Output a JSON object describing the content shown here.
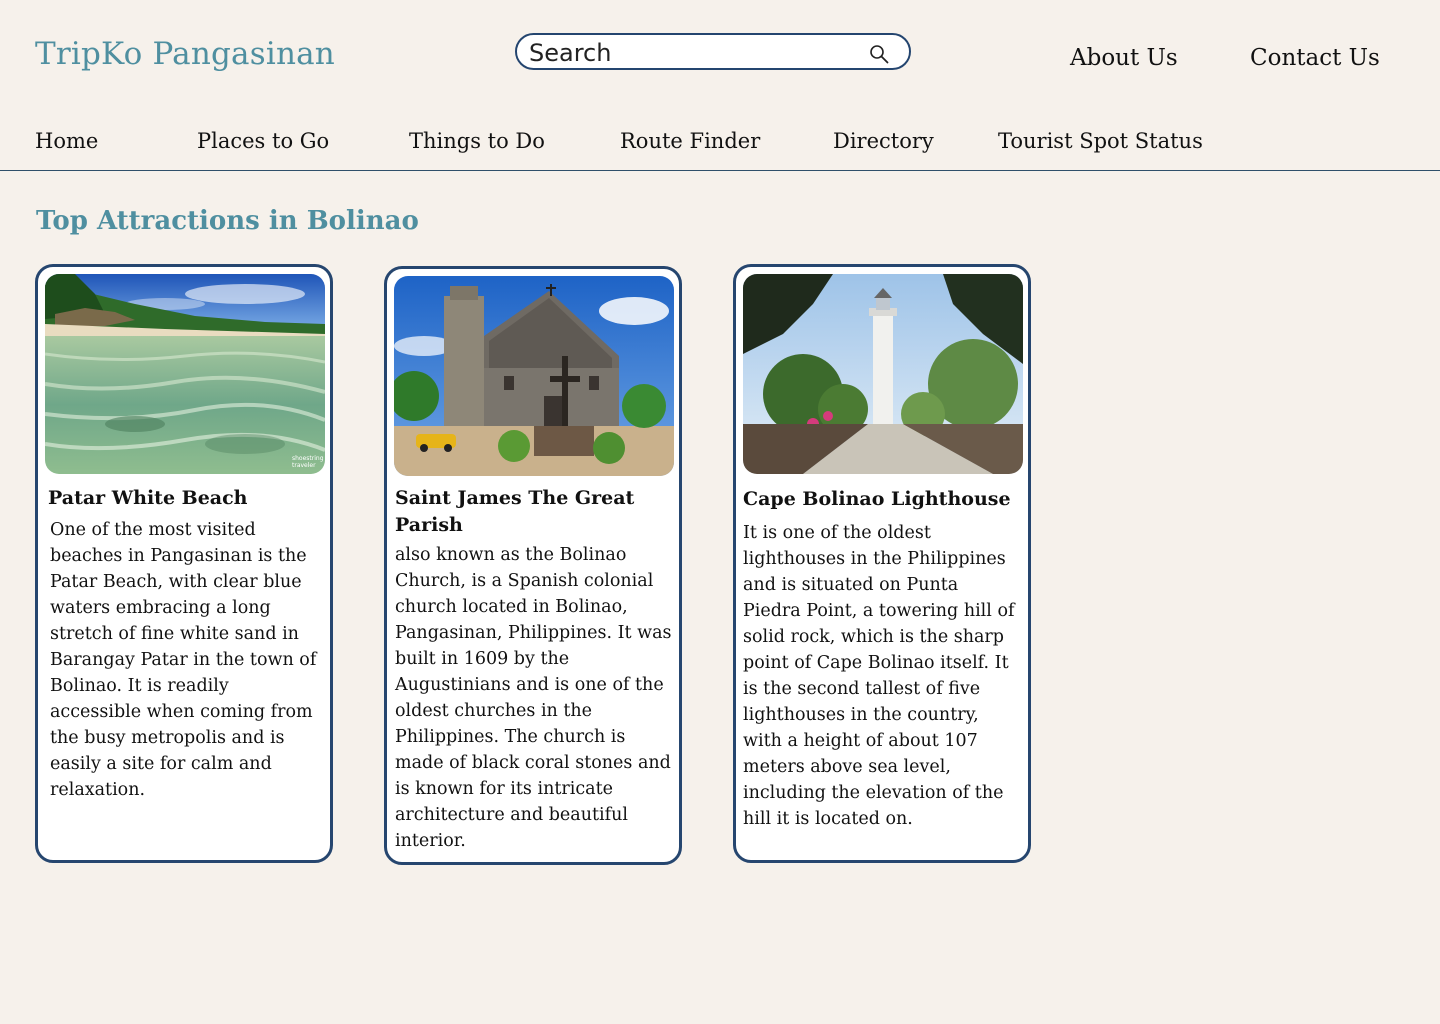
{
  "header": {
    "brand": "TripKo Pangasinan",
    "search_placeholder": "Search",
    "about_label": "About Us",
    "contact_label": "Contact Us"
  },
  "nav": {
    "items": [
      "Home",
      "Places to Go",
      "Things to Do",
      "Route Finder",
      "Directory",
      "Tourist Spot Status"
    ]
  },
  "section": {
    "title": "Top Attractions in Bolinao"
  },
  "cards": [
    {
      "title": "Patar White Beach",
      "description": "One of the most visited beaches in Pangasinan is the Patar Beach, with clear blue waters embracing a long stretch of fine white sand in Barangay Patar in the town of Bolinao. It is readily accessible when coming from the busy metropolis and is easily a site for calm and relaxation.",
      "watermark": "shoestring traveler"
    },
    {
      "title": "Saint James The Great Parish",
      "description": "also known as the Bolinao Church, is a Spanish colonial church located in Bolinao, Pangasinan, Philippines. It was built in 1609 by the Augustinians and is one of the oldest churches in the Philippines. The church is made of black coral stones and is known for its intricate architecture and beautiful interior."
    },
    {
      "title": "Cape Bolinao Lighthouse",
      "description": "It is one of the oldest lighthouses in the Philippines and is situated on Punta Piedra Point, a towering hill of solid rock, which is the sharp point of Cape Bolinao itself. It is the second tallest of five lighthouses in the country, with a height of about 107 meters above sea level, including the elevation of the hill it is located on."
    }
  ],
  "colors": {
    "background": "#f6f1eb",
    "accent": "#4f8fa0",
    "border": "#26466f"
  }
}
